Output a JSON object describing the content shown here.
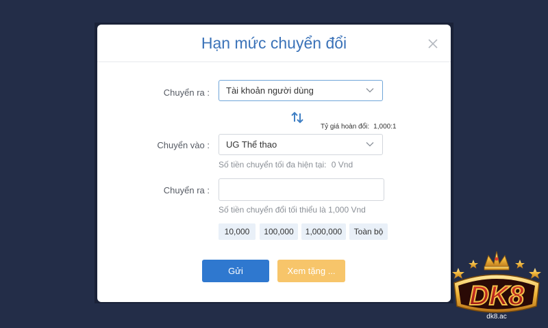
{
  "modal": {
    "title": "Hạn mức chuyển đổi",
    "close_icon": "close-icon"
  },
  "form": {
    "from": {
      "label": "Chuyển ra :",
      "value": "Tài khoản người dùng"
    },
    "swap_icon": "swap-vertical-icon",
    "rate": {
      "label": "Tỷ giá hoàn đổi:",
      "value": "1,000:1"
    },
    "to": {
      "label": "Chuyển vào :",
      "value": "UG Thể thao",
      "hint_label": "Số tiền chuyển tối đa hiện tại:",
      "hint_value": "0 Vnd"
    },
    "amount": {
      "label": "Chuyển ra :",
      "value": "",
      "placeholder": "",
      "hint": "Số tiền chuyển đổi tối thiểu là 1,000 Vnd"
    },
    "quick_amounts": [
      "10,000",
      "100,000",
      "1,000,000",
      "Toàn bộ"
    ]
  },
  "actions": {
    "submit_label": "Gửi",
    "bonus_label": "Xem tặng ..."
  },
  "logo": {
    "text": "DK8",
    "domain": "dk8.ac"
  },
  "colors": {
    "backdrop": "#232d48",
    "title": "#3a72b8",
    "primary": "#2f78cf",
    "secondary": "#f7c56a",
    "chip_bg": "#e9f0f8"
  }
}
